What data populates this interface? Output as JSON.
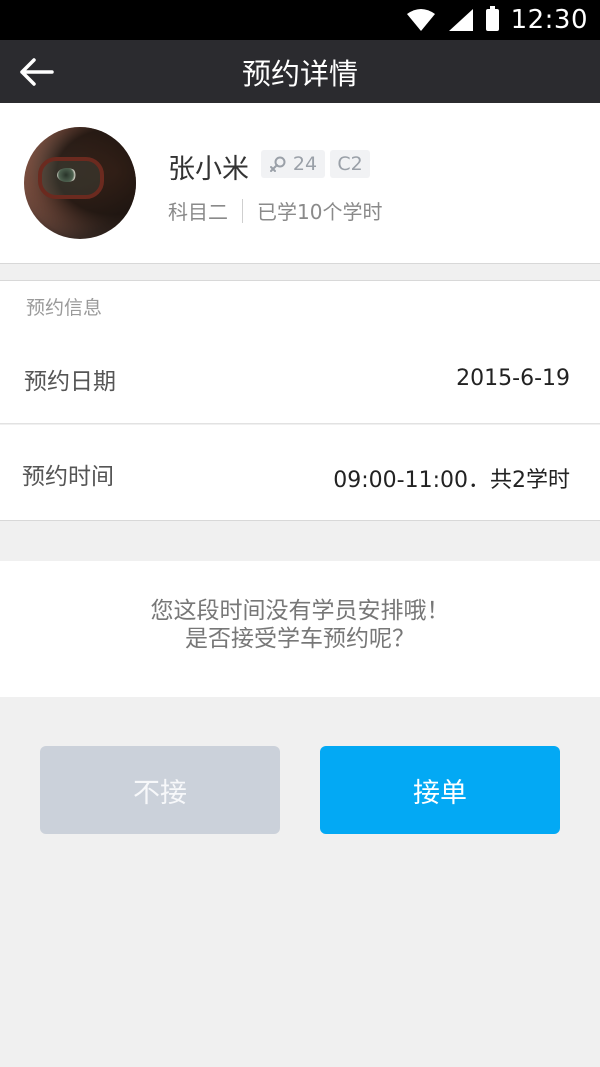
{
  "status_bar": {
    "time": "12:30",
    "icons": [
      "wifi-icon",
      "signal-icon",
      "battery-icon"
    ]
  },
  "nav": {
    "back_icon": "arrow-left-icon",
    "title": "预约详情"
  },
  "student": {
    "name": "张小米",
    "age": "24",
    "gender_icon": "female-icon",
    "license": "C2",
    "subject": "科目二",
    "hours_learned": "已学10个学时"
  },
  "booking": {
    "section_title": "预约信息",
    "date_label": "预约日期",
    "date_value": "2015-6-19",
    "time_label": "预约时间",
    "time_value": "09:00-11:00．共2学时"
  },
  "notice": {
    "line1": "您这段时间没有学员安排哦！",
    "line2": "是否接受学车预约呢？"
  },
  "actions": {
    "reject_label": "不接",
    "accept_label": "接单"
  },
  "colors": {
    "nav_bg": "#2b2b2f",
    "accent": "#03a9f4",
    "reject_bg": "#cbd1da"
  }
}
